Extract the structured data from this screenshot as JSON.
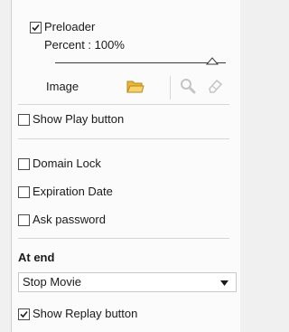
{
  "preloader": {
    "label": "Preloader",
    "checked": true,
    "percent_text": "Percent : 100%",
    "percent_value": 100,
    "image_label": "Image",
    "tools": [
      "folder-icon",
      "search-icon",
      "eraser-icon"
    ]
  },
  "options": {
    "show_play_button": {
      "label": "Show Play button",
      "checked": false
    },
    "domain_lock": {
      "label": "Domain Lock",
      "checked": false
    },
    "expiration_date": {
      "label": "Expiration Date",
      "checked": false
    },
    "ask_password": {
      "label": "Ask password",
      "checked": false
    }
  },
  "at_end": {
    "heading": "At end",
    "selected": "Stop Movie",
    "show_replay": {
      "label": "Show Replay button",
      "checked": true
    }
  }
}
